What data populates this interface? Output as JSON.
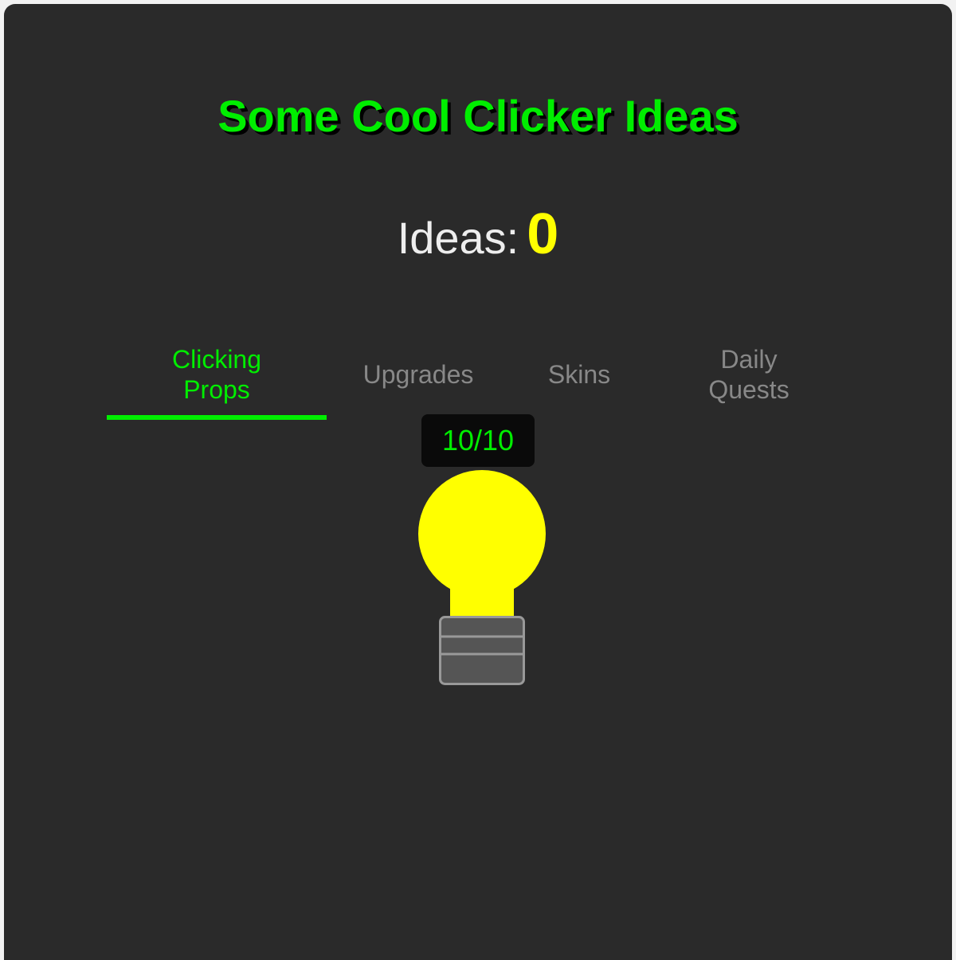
{
  "title": "Some Cool Clicker Ideas",
  "counter": {
    "label": "Ideas:",
    "value": "0"
  },
  "tabs": [
    {
      "label": "Clicking Props",
      "active": true
    },
    {
      "label": "Upgrades",
      "active": false
    },
    {
      "label": "Skins",
      "active": false
    },
    {
      "label": "Daily Quests",
      "active": false
    }
  ],
  "prop": {
    "charges": "10/10",
    "icon": "lightbulb-icon"
  },
  "colors": {
    "background": "#2a2a2a",
    "accent": "#00ee00",
    "idea_value": "#ffff00",
    "bulb": "#ffff00",
    "bulb_base": "#555555",
    "inactive_tab": "#888888"
  }
}
